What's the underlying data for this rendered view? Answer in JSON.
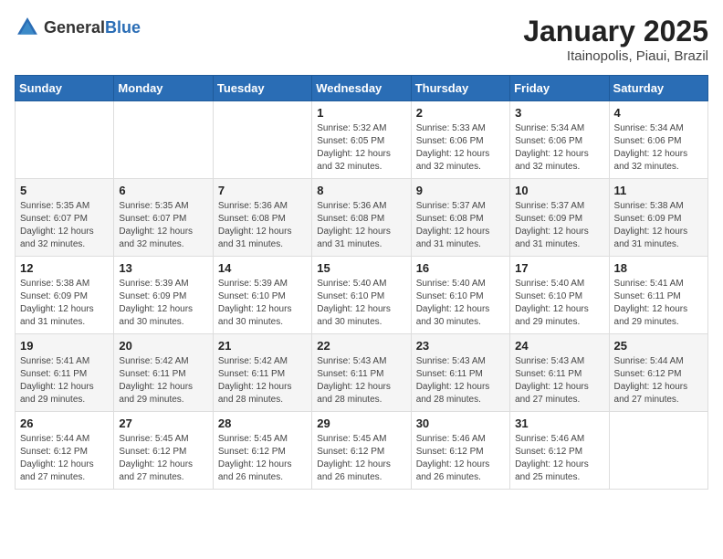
{
  "header": {
    "logo_general": "General",
    "logo_blue": "Blue",
    "month_title": "January 2025",
    "location": "Itainopolis, Piaui, Brazil"
  },
  "days_of_week": [
    "Sunday",
    "Monday",
    "Tuesday",
    "Wednesday",
    "Thursday",
    "Friday",
    "Saturday"
  ],
  "weeks": [
    [
      {
        "day": "",
        "info": ""
      },
      {
        "day": "",
        "info": ""
      },
      {
        "day": "",
        "info": ""
      },
      {
        "day": "1",
        "info": "Sunrise: 5:32 AM\nSunset: 6:05 PM\nDaylight: 12 hours\nand 32 minutes."
      },
      {
        "day": "2",
        "info": "Sunrise: 5:33 AM\nSunset: 6:06 PM\nDaylight: 12 hours\nand 32 minutes."
      },
      {
        "day": "3",
        "info": "Sunrise: 5:34 AM\nSunset: 6:06 PM\nDaylight: 12 hours\nand 32 minutes."
      },
      {
        "day": "4",
        "info": "Sunrise: 5:34 AM\nSunset: 6:06 PM\nDaylight: 12 hours\nand 32 minutes."
      }
    ],
    [
      {
        "day": "5",
        "info": "Sunrise: 5:35 AM\nSunset: 6:07 PM\nDaylight: 12 hours\nand 32 minutes."
      },
      {
        "day": "6",
        "info": "Sunrise: 5:35 AM\nSunset: 6:07 PM\nDaylight: 12 hours\nand 32 minutes."
      },
      {
        "day": "7",
        "info": "Sunrise: 5:36 AM\nSunset: 6:08 PM\nDaylight: 12 hours\nand 31 minutes."
      },
      {
        "day": "8",
        "info": "Sunrise: 5:36 AM\nSunset: 6:08 PM\nDaylight: 12 hours\nand 31 minutes."
      },
      {
        "day": "9",
        "info": "Sunrise: 5:37 AM\nSunset: 6:08 PM\nDaylight: 12 hours\nand 31 minutes."
      },
      {
        "day": "10",
        "info": "Sunrise: 5:37 AM\nSunset: 6:09 PM\nDaylight: 12 hours\nand 31 minutes."
      },
      {
        "day": "11",
        "info": "Sunrise: 5:38 AM\nSunset: 6:09 PM\nDaylight: 12 hours\nand 31 minutes."
      }
    ],
    [
      {
        "day": "12",
        "info": "Sunrise: 5:38 AM\nSunset: 6:09 PM\nDaylight: 12 hours\nand 31 minutes."
      },
      {
        "day": "13",
        "info": "Sunrise: 5:39 AM\nSunset: 6:09 PM\nDaylight: 12 hours\nand 30 minutes."
      },
      {
        "day": "14",
        "info": "Sunrise: 5:39 AM\nSunset: 6:10 PM\nDaylight: 12 hours\nand 30 minutes."
      },
      {
        "day": "15",
        "info": "Sunrise: 5:40 AM\nSunset: 6:10 PM\nDaylight: 12 hours\nand 30 minutes."
      },
      {
        "day": "16",
        "info": "Sunrise: 5:40 AM\nSunset: 6:10 PM\nDaylight: 12 hours\nand 30 minutes."
      },
      {
        "day": "17",
        "info": "Sunrise: 5:40 AM\nSunset: 6:10 PM\nDaylight: 12 hours\nand 29 minutes."
      },
      {
        "day": "18",
        "info": "Sunrise: 5:41 AM\nSunset: 6:11 PM\nDaylight: 12 hours\nand 29 minutes."
      }
    ],
    [
      {
        "day": "19",
        "info": "Sunrise: 5:41 AM\nSunset: 6:11 PM\nDaylight: 12 hours\nand 29 minutes."
      },
      {
        "day": "20",
        "info": "Sunrise: 5:42 AM\nSunset: 6:11 PM\nDaylight: 12 hours\nand 29 minutes."
      },
      {
        "day": "21",
        "info": "Sunrise: 5:42 AM\nSunset: 6:11 PM\nDaylight: 12 hours\nand 28 minutes."
      },
      {
        "day": "22",
        "info": "Sunrise: 5:43 AM\nSunset: 6:11 PM\nDaylight: 12 hours\nand 28 minutes."
      },
      {
        "day": "23",
        "info": "Sunrise: 5:43 AM\nSunset: 6:11 PM\nDaylight: 12 hours\nand 28 minutes."
      },
      {
        "day": "24",
        "info": "Sunrise: 5:43 AM\nSunset: 6:11 PM\nDaylight: 12 hours\nand 27 minutes."
      },
      {
        "day": "25",
        "info": "Sunrise: 5:44 AM\nSunset: 6:12 PM\nDaylight: 12 hours\nand 27 minutes."
      }
    ],
    [
      {
        "day": "26",
        "info": "Sunrise: 5:44 AM\nSunset: 6:12 PM\nDaylight: 12 hours\nand 27 minutes."
      },
      {
        "day": "27",
        "info": "Sunrise: 5:45 AM\nSunset: 6:12 PM\nDaylight: 12 hours\nand 27 minutes."
      },
      {
        "day": "28",
        "info": "Sunrise: 5:45 AM\nSunset: 6:12 PM\nDaylight: 12 hours\nand 26 minutes."
      },
      {
        "day": "29",
        "info": "Sunrise: 5:45 AM\nSunset: 6:12 PM\nDaylight: 12 hours\nand 26 minutes."
      },
      {
        "day": "30",
        "info": "Sunrise: 5:46 AM\nSunset: 6:12 PM\nDaylight: 12 hours\nand 26 minutes."
      },
      {
        "day": "31",
        "info": "Sunrise: 5:46 AM\nSunset: 6:12 PM\nDaylight: 12 hours\nand 25 minutes."
      },
      {
        "day": "",
        "info": ""
      }
    ]
  ]
}
